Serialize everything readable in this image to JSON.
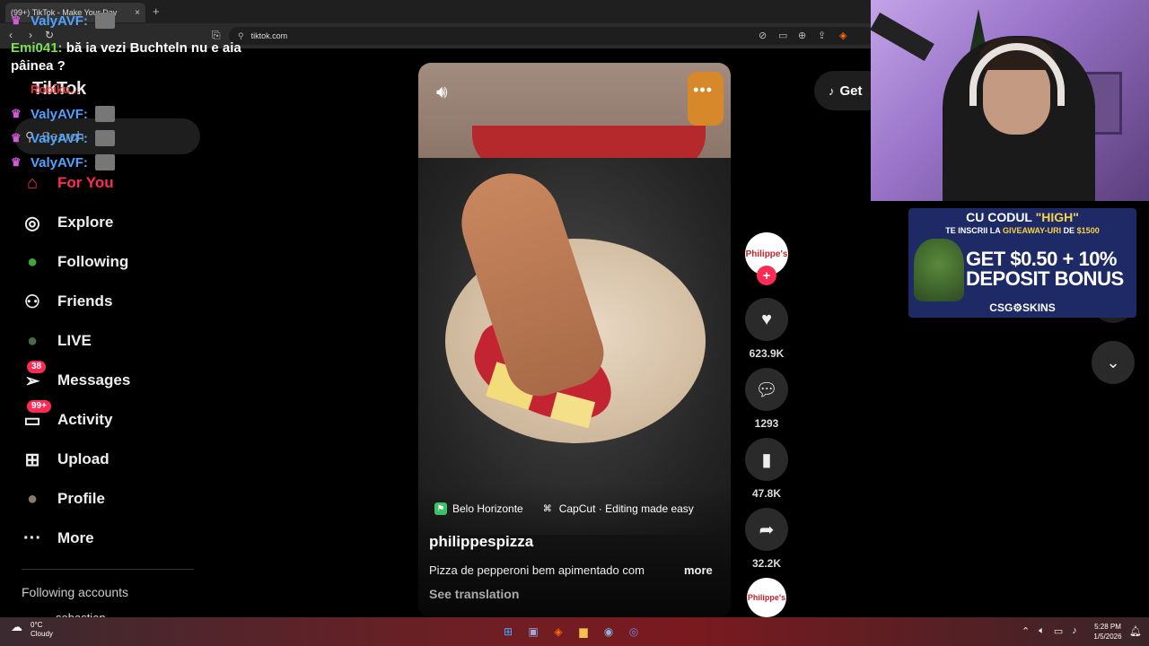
{
  "browser": {
    "tab_title": "(99+) TikTok - Make Your Day",
    "tab_close": "×",
    "new_tab": "+",
    "url": "tiktok.com"
  },
  "tiktok": {
    "logo": "TikTok",
    "search_placeholder": "Search",
    "nav": [
      {
        "label": "For You",
        "icon": "home-icon",
        "glyph": "⌂",
        "active": true
      },
      {
        "label": "Explore",
        "icon": "compass-icon",
        "glyph": "◎",
        "active": false
      },
      {
        "label": "Following",
        "icon": "following-avatar-icon",
        "glyph": "●",
        "active": false
      },
      {
        "label": "Friends",
        "icon": "friends-icon",
        "glyph": "⚇",
        "active": false
      },
      {
        "label": "LIVE",
        "icon": "live-avatar-icon",
        "glyph": "●",
        "active": false
      },
      {
        "label": "Messages",
        "icon": "messages-icon",
        "glyph": "➢",
        "badge": "38",
        "active": false
      },
      {
        "label": "Activity",
        "icon": "activity-icon",
        "glyph": "▭",
        "badge": "99+",
        "active": false
      },
      {
        "label": "Upload",
        "icon": "upload-icon",
        "glyph": "⊞",
        "active": false
      },
      {
        "label": "Profile",
        "icon": "profile-avatar-icon",
        "glyph": "●",
        "active": false
      },
      {
        "label": "More",
        "icon": "more-dots-icon",
        "glyph": "···",
        "active": false
      }
    ],
    "following_accounts_title": "Following accounts",
    "following_first": "sebastian",
    "get_app": "Get"
  },
  "video": {
    "location": "Belo Horizonte",
    "capcut": "CapCut · Editing made easy",
    "author": "philippespizza",
    "caption": "Pizza de pepperoni bem apimentado com",
    "caption_more": "more",
    "see_translation": "See translation",
    "avatar_label": "Philippe's",
    "likes": "623.9K",
    "comments": "1293",
    "saves": "47.8K",
    "shares": "32.2K"
  },
  "chat": {
    "lines": [
      {
        "name": "ValyAVF:"
      },
      {
        "name": "ValyAVF:"
      },
      {
        "name": "ValyAVF:"
      },
      {
        "name": "ValyAVF:"
      }
    ],
    "message_name": "Emi041:",
    "message_text": "bă ia vezi Buchteln nu e aia pâinea ?",
    "red_name": "Robiku..."
  },
  "ad": {
    "line1_a": "CU CODUL ",
    "line1_b": "\"HIGH\"",
    "line2_a": "TE INSCRII LA ",
    "line2_b": "GIVEAWAY-URI",
    "line2_c": " DE ",
    "line2_d": "$1500",
    "main1": "GET $0.50 + 10%",
    "main2": "DEPOSIT BONUS",
    "brand": "CSG⚙SKINS"
  },
  "taskbar": {
    "temp": "0°C",
    "weather": "Cloudy",
    "time": "5:28 PM",
    "date": "1/5/2026"
  },
  "colors": {
    "accent": "#fe2c55",
    "chat_name": "#4fa3ff"
  }
}
